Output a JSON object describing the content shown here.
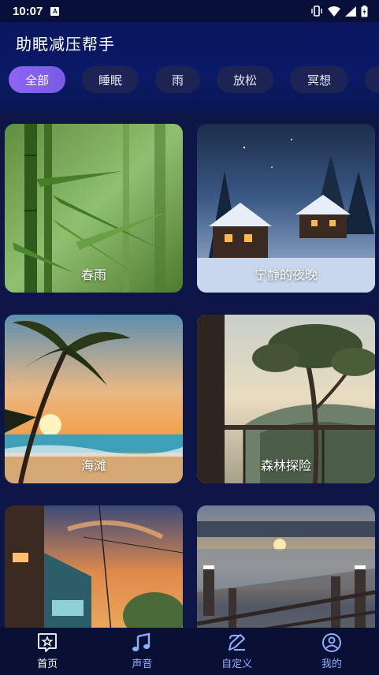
{
  "status_bar": {
    "time": "10:07",
    "notification_letter": "A"
  },
  "app": {
    "title": "助眠减压帮手"
  },
  "tabs": [
    {
      "label": "全部",
      "active": true
    },
    {
      "label": "睡眠",
      "active": false
    },
    {
      "label": "雨",
      "active": false
    },
    {
      "label": "放松",
      "active": false
    },
    {
      "label": "冥想",
      "active": false
    }
  ],
  "cards": [
    {
      "title": "春雨",
      "icon": "bamboo-rain-image"
    },
    {
      "title": "宁静的夜晚",
      "icon": "snowy-village-night-image"
    },
    {
      "title": "海滩",
      "icon": "beach-sunset-image"
    },
    {
      "title": "森林探险",
      "icon": "forest-house-image"
    },
    {
      "title": "",
      "icon": "train-sunset-image"
    },
    {
      "title": "",
      "icon": "winter-lake-image"
    }
  ],
  "bottom_nav": [
    {
      "label": "首页",
      "icon": "home-star-icon",
      "active": true
    },
    {
      "label": "声音",
      "icon": "music-note-icon",
      "active": false
    },
    {
      "label": "自定义",
      "icon": "edit-icon",
      "active": false
    },
    {
      "label": "我的",
      "icon": "profile-icon",
      "active": false
    }
  ],
  "colors": {
    "background": "#0b1540",
    "accent": "#8a66f2",
    "tab_bg": "#1d2454",
    "nav_inactive": "#8fb0ff"
  }
}
